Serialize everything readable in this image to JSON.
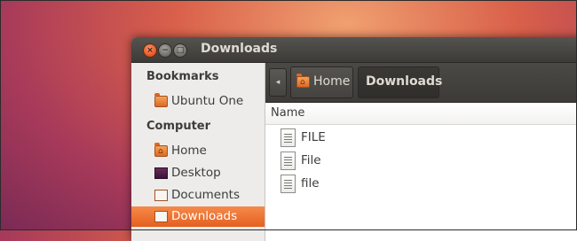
{
  "window": {
    "title": "Downloads"
  },
  "sidebar": {
    "sections": [
      {
        "heading": "Bookmarks",
        "items": [
          {
            "label": "Ubuntu One",
            "icon": "folder-icon"
          }
        ]
      },
      {
        "heading": "Computer",
        "items": [
          {
            "label": "Home",
            "icon": "home-folder-icon"
          },
          {
            "label": "Desktop",
            "icon": "desktop-icon"
          },
          {
            "label": "Documents",
            "icon": "documents-folder-icon"
          },
          {
            "label": "Downloads",
            "icon": "downloads-folder-icon",
            "selected": true
          }
        ]
      }
    ]
  },
  "toolbar": {
    "breadcrumbs": [
      {
        "label": "Home",
        "icon": "home-folder-icon"
      },
      {
        "label": "Downloads",
        "active": true
      }
    ]
  },
  "file_list": {
    "column_header": "Name",
    "files": [
      {
        "name": "FILE",
        "icon": "text-document-icon"
      },
      {
        "name": "File",
        "icon": "text-document-icon"
      },
      {
        "name": "file",
        "icon": "text-document-icon"
      }
    ]
  },
  "colors": {
    "selection_accent": "#e95420",
    "titlebar": "#3c3b37"
  }
}
